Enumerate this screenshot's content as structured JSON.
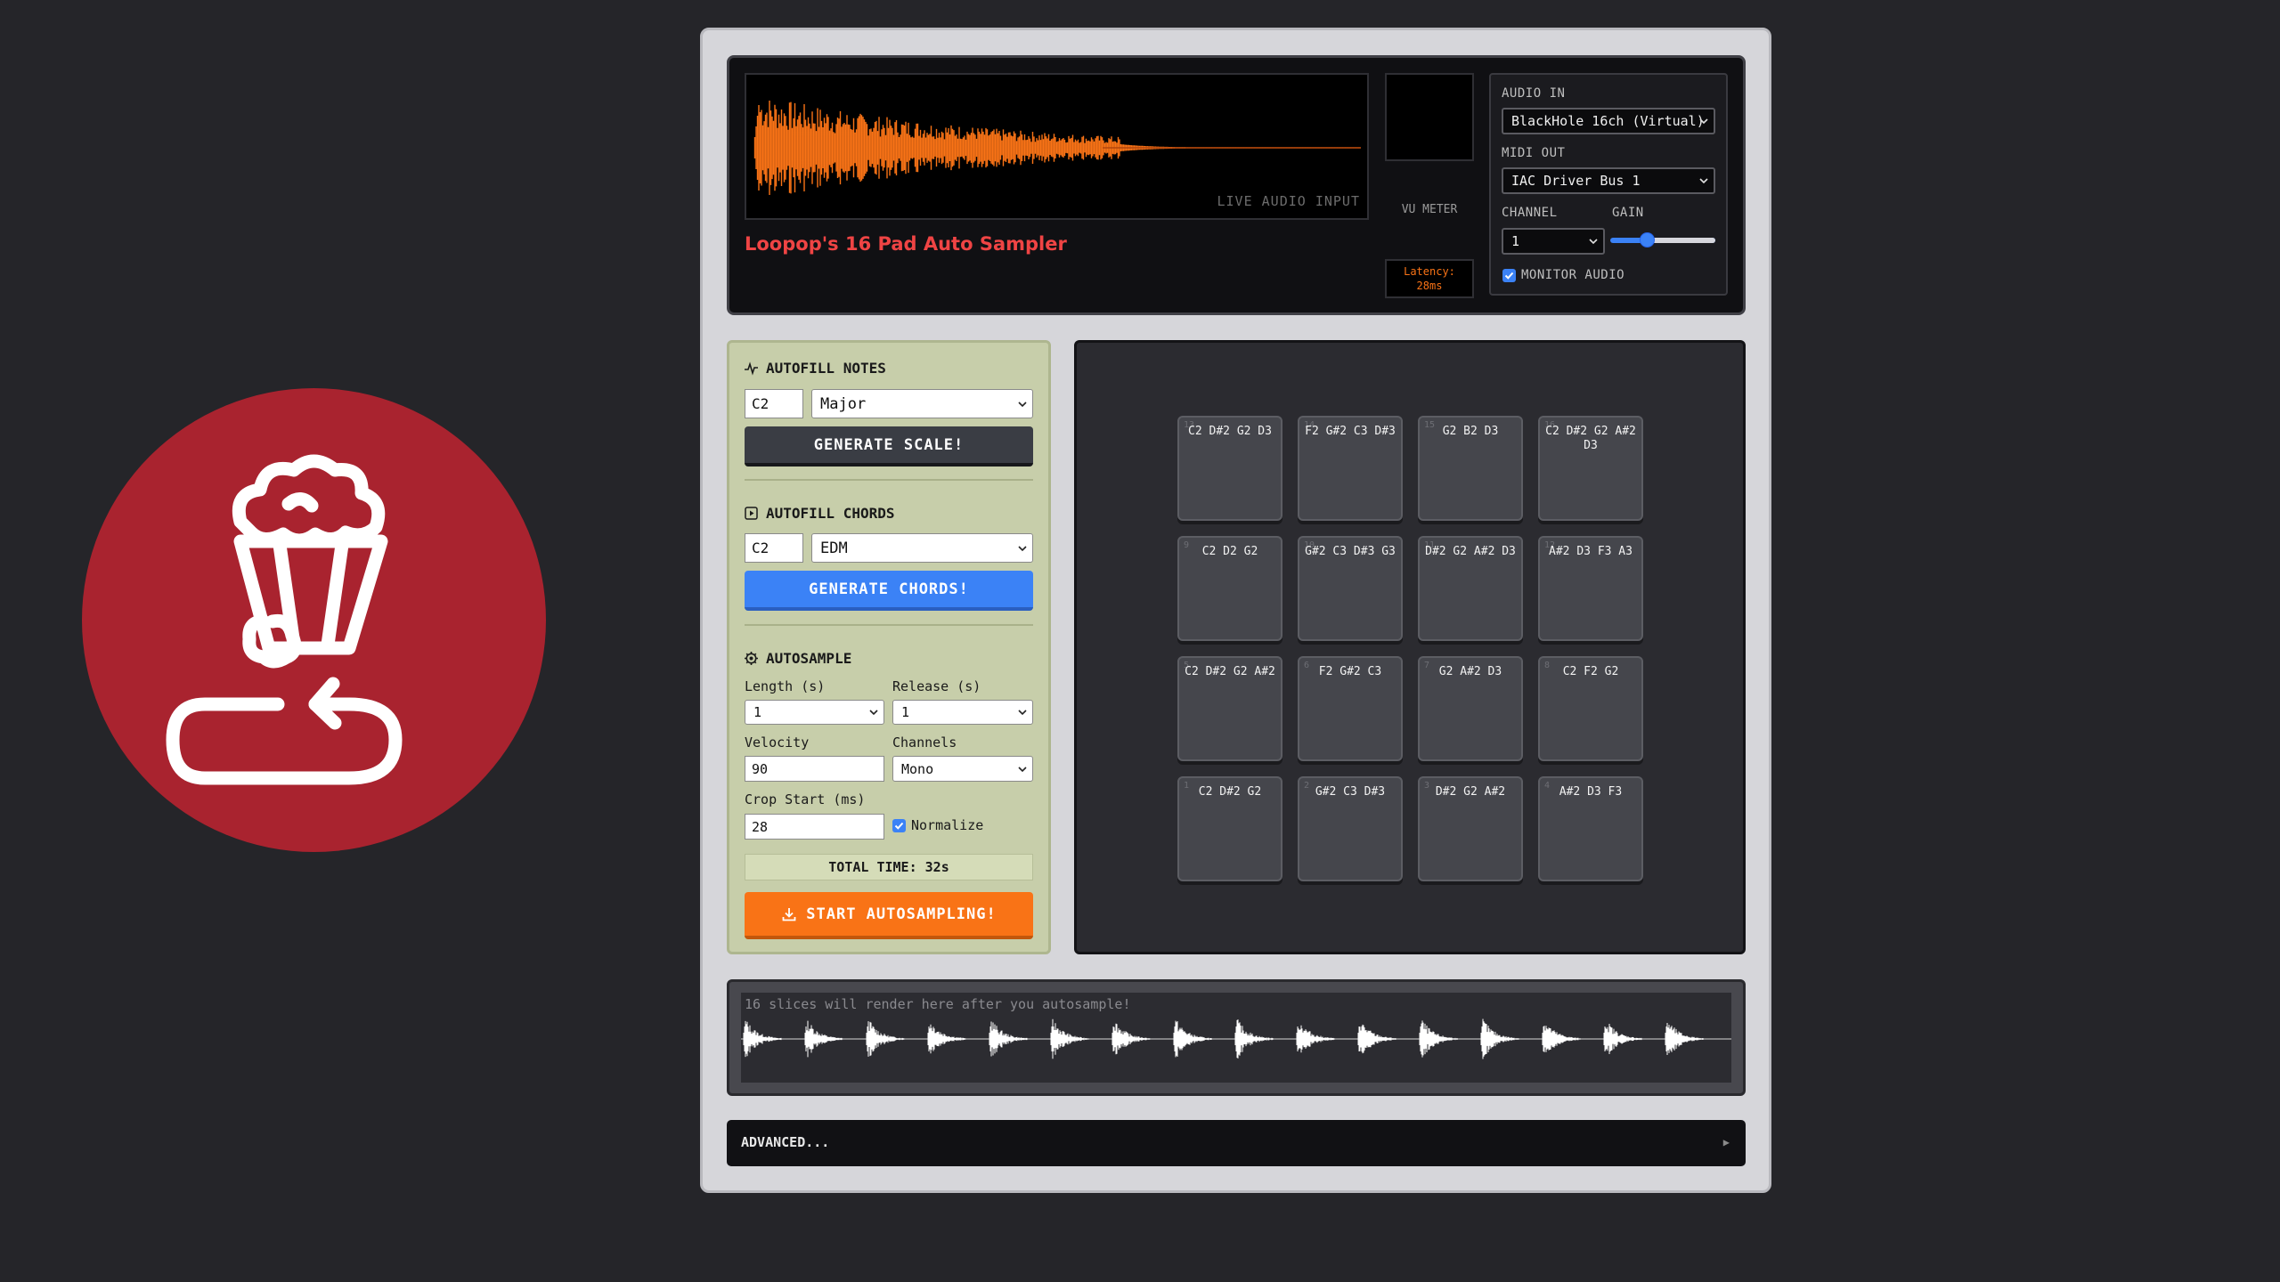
{
  "app": {
    "title": "Loopop's 16 Pad Auto Sampler",
    "live_audio_label": "LIVE AUDIO INPUT",
    "vu_meter_label": "VU METER",
    "latency_label": "Latency:",
    "latency_value": "28ms"
  },
  "io": {
    "audio_in_label": "AUDIO IN",
    "audio_in_value": "BlackHole 16ch (Virtual)",
    "midi_out_label": "MIDI OUT",
    "midi_out_value": "IAC Driver Bus 1",
    "channel_label": "CHANNEL",
    "channel_value": "1",
    "gain_label": "GAIN",
    "gain_level": 0.3,
    "monitor_label": "MONITOR AUDIO",
    "monitor_checked": true
  },
  "autofill_notes": {
    "heading": "AUTOFILL NOTES",
    "root": "C2",
    "scale": "Major",
    "button": "GENERATE SCALE!"
  },
  "autofill_chords": {
    "heading": "AUTOFILL CHORDS",
    "root": "C2",
    "style": "EDM",
    "button": "GENERATE CHORDS!"
  },
  "autosample": {
    "heading": "AUTOSAMPLE",
    "length_label": "Length (s)",
    "length_value": "1",
    "release_label": "Release (s)",
    "release_value": "1",
    "velocity_label": "Velocity",
    "velocity_value": "90",
    "channels_label": "Channels",
    "channels_value": "Mono",
    "crop_label": "Crop Start (ms)",
    "crop_value": "28",
    "normalize_label": "Normalize",
    "normalize_checked": true,
    "total_time": "TOTAL TIME: 32s",
    "start_button": "START AUTOSAMPLING!"
  },
  "pads": [
    {
      "num": "13",
      "notes": "C2 D#2 G2 D3"
    },
    {
      "num": "14",
      "notes": "F2 G#2 C3 D#3"
    },
    {
      "num": "15",
      "notes": "G2 B2 D3"
    },
    {
      "num": "16",
      "notes": "C2 D#2 G2 A#2 D3"
    },
    {
      "num": "9",
      "notes": "C2 D2 G2"
    },
    {
      "num": "10",
      "notes": "G#2 C3 D#3 G3"
    },
    {
      "num": "11",
      "notes": "D#2 G2 A#2 D3"
    },
    {
      "num": "12",
      "notes": "A#2 D3 F3 A3"
    },
    {
      "num": "5",
      "notes": "C2 D#2 G2 A#2"
    },
    {
      "num": "6",
      "notes": "F2 G#2 C3"
    },
    {
      "num": "7",
      "notes": "G2 A#2 D3"
    },
    {
      "num": "8",
      "notes": "C2 F2 G2"
    },
    {
      "num": "1",
      "notes": "C2 D#2 G2"
    },
    {
      "num": "2",
      "notes": "G#2 C3 D#3"
    },
    {
      "num": "3",
      "notes": "D#2 G2 A#2"
    },
    {
      "num": "4",
      "notes": "A#2 D3 F3"
    }
  ],
  "slices": {
    "hint": "16 slices will render here after you autosample!",
    "count": 16
  },
  "advanced": {
    "label": "ADVANCED...",
    "arrow": "▶"
  },
  "colors": {
    "accent_orange": "#f97316",
    "accent_blue": "#3b82f6",
    "title_red": "#ef4444",
    "logo_red": "#a9232f"
  }
}
